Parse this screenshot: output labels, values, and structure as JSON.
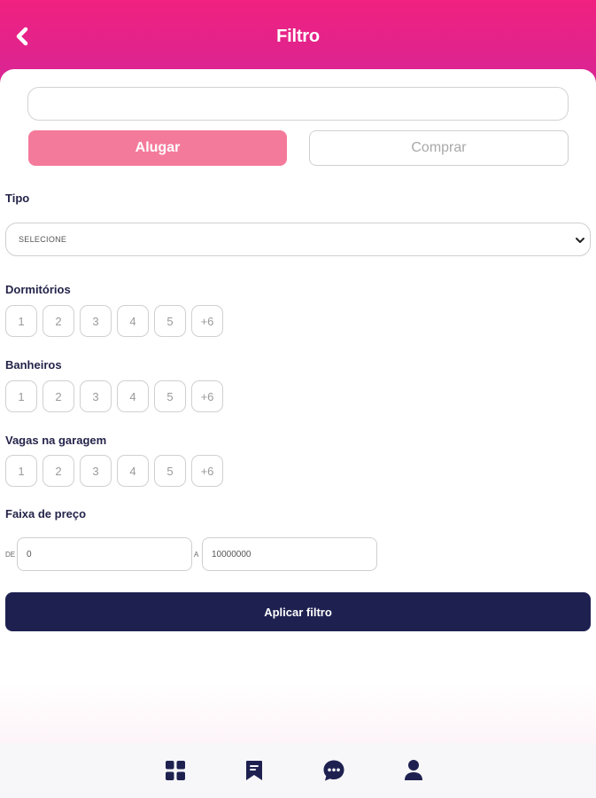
{
  "header": {
    "title": "Filtro",
    "back_icon": "chevron-left-icon"
  },
  "search": {
    "value": "",
    "placeholder": ""
  },
  "mode": {
    "rent_label": "Alugar",
    "buy_label": "Comprar",
    "selected": "Alugar"
  },
  "tipo": {
    "label": "Tipo",
    "selected": "SELECIONE"
  },
  "dormitorios": {
    "label": "Dormitórios",
    "options": [
      "1",
      "2",
      "3",
      "4",
      "5",
      "+6"
    ]
  },
  "banheiros": {
    "label": "Banheiros",
    "options": [
      "1",
      "2",
      "3",
      "4",
      "5",
      "+6"
    ]
  },
  "vagas": {
    "label": "Vagas na garagem",
    "options": [
      "1",
      "2",
      "3",
      "4",
      "5",
      "+6"
    ]
  },
  "preco": {
    "label": "Faixa de preço",
    "from_prefix": "DE",
    "from_value": "0",
    "to_prefix": "A",
    "to_value": "10000000"
  },
  "apply": {
    "label": "Aplicar filtro"
  },
  "nav": {
    "items": [
      "grid-icon",
      "bookmark-icon",
      "chat-icon",
      "user-icon"
    ]
  },
  "colors": {
    "header_gradient_top": "#f0217f",
    "header_gradient_bottom": "#d72596",
    "accent_pink": "#f47a9b",
    "navy": "#1e2150"
  }
}
